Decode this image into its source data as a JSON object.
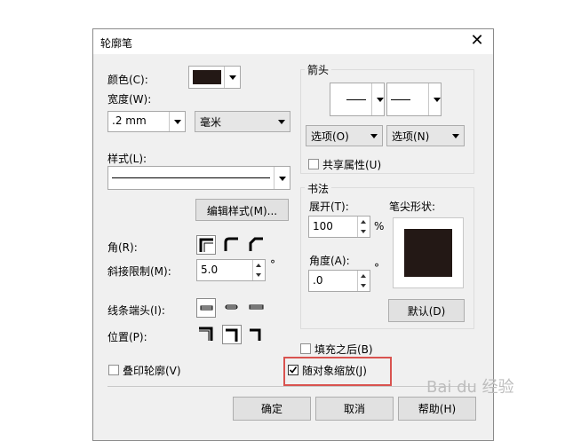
{
  "dialog": {
    "title": "轮廓笔",
    "close": "✕"
  },
  "left": {
    "color_label": "颜色(C):",
    "color_swatch": "#231815",
    "width_label": "宽度(W):",
    "width_value": ".2 mm",
    "unit_value": "毫米",
    "style_label": "样式(L):",
    "edit_style_button": "编辑样式(M)...",
    "corner_label": "角(R):",
    "miter_label": "斜接限制(M):",
    "miter_value": "5.0",
    "degree": "°",
    "linecap_label": "线条端头(I):",
    "position_label": "位置(P):",
    "overprint_label": "叠印轮廓(V)"
  },
  "arrows": {
    "group_title": "箭头",
    "option_left": "选项(O)",
    "option_right": "选项(N)",
    "share_label": "共享属性(U)"
  },
  "calligraphy": {
    "group_title": "书法",
    "stretch_label": "展开(T):",
    "stretch_value": "100",
    "percent": "%",
    "nib_label": "笔尖形状:",
    "angle_label": "角度(A):",
    "angle_value": ".0",
    "degree": "°",
    "default_button": "默认(D)"
  },
  "options": {
    "fill_behind_label": "填充之后(B)",
    "scale_label": "随对象缩放(J)"
  },
  "footer": {
    "ok": "确定",
    "cancel": "取消",
    "help": "帮助(H)"
  },
  "watermark": "Bai du 经验"
}
